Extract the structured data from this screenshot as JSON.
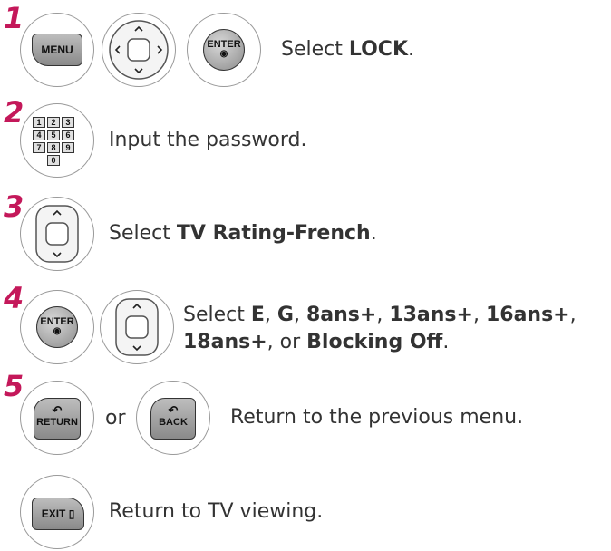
{
  "steps": [
    {
      "number": "1",
      "text_parts": [
        "Select ",
        "LOCK",
        "."
      ]
    },
    {
      "number": "2",
      "text": "Input the password."
    },
    {
      "number": "3",
      "text_parts": [
        "Select ",
        "TV Rating-French",
        "."
      ]
    },
    {
      "number": "4",
      "line1": [
        "Select ",
        "E",
        ", ",
        "G",
        ", ",
        "8ans+",
        ", ",
        "13ans+",
        ", ",
        "16ans+",
        ","
      ],
      "line2": [
        "18ans+",
        ",  or ",
        "Blocking Off",
        "."
      ]
    },
    {
      "number": "5",
      "or_label": "or",
      "text": "Return to the previous menu."
    },
    {
      "text": "Return to TV viewing."
    }
  ],
  "buttons": {
    "menu": "MENU",
    "enter": "ENTER",
    "enter_dot": "◉",
    "return": "RETURN",
    "back": "BACK",
    "exit": "EXIT"
  },
  "numpad": [
    "1",
    "2",
    "3",
    "4",
    "5",
    "6",
    "7",
    "8",
    "9",
    "0"
  ],
  "accent_color": "#c4185a"
}
